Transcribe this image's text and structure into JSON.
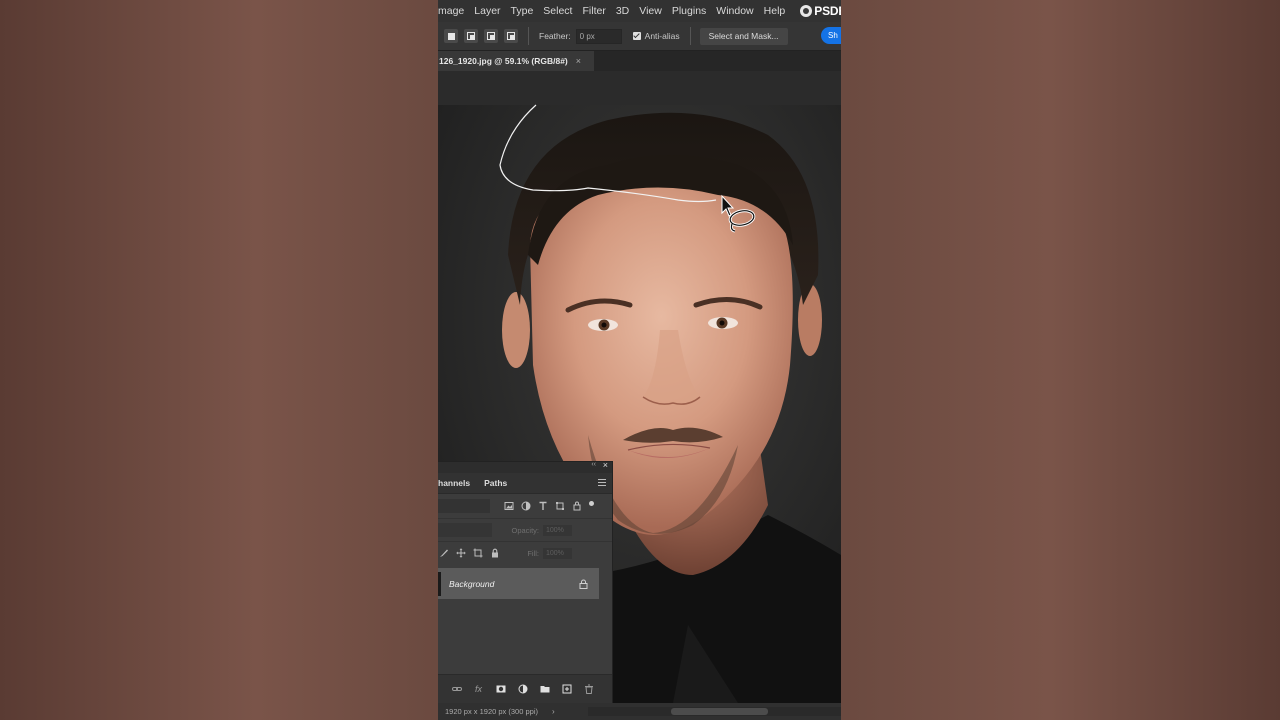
{
  "menubar": {
    "items": [
      "mage",
      "Layer",
      "Type",
      "Select",
      "Filter",
      "3D",
      "View",
      "Plugins",
      "Window",
      "Help"
    ],
    "logo_text": "PSDESIRE"
  },
  "options": {
    "feather_label": "Feather:",
    "feather_value": "0 px",
    "antialias_label": "Anti-alias",
    "antialias_checked": true,
    "select_mask_label": "Select and Mask...",
    "share_label": "Sh"
  },
  "document": {
    "tab_title": "126_1920.jpg @ 59.1% (RGB/8#)",
    "close_glyph": "×"
  },
  "layers_panel": {
    "tabs": [
      "hannels",
      "Paths"
    ],
    "opacity_label": "Opacity:",
    "opacity_value": "100%",
    "fill_label": "Fill:",
    "fill_value": "100%",
    "layer_name": "Background",
    "close_glyph": "×",
    "collapse_glyph": "‹‹",
    "fx_label": "fx"
  },
  "statusbar": {
    "dimensions": "1920 px x 1920 px (300 ppi)",
    "arrow": "›"
  },
  "tool": {
    "active": "lasso-tool"
  }
}
